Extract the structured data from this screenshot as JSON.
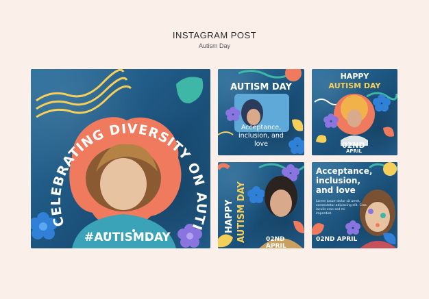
{
  "header": {
    "title": "INSTAGRAM POST",
    "subtitle": "Autism Day"
  },
  "post1": {
    "arc_text": "CELEBRATING DIVERSITY ON AUTISM DAY",
    "hashtag": "#AUTISMDAY"
  },
  "post2": {
    "title": "AUTISM DAY",
    "body_lines": [
      "Acceptance,",
      "inclusion, and",
      "love"
    ]
  },
  "post3": {
    "title_line1": "HAPPY",
    "title_line2": "AUTISM DAY",
    "date_day": "02ND",
    "date_month": "APRIL"
  },
  "post4": {
    "vertical_line1": "HAPPY",
    "vertical_line2": "AUTISM DAY",
    "date": "02ND APRIL"
  },
  "post5": {
    "heading_lines": [
      "Acceptance,",
      "inclusion,",
      "and love"
    ],
    "body_lines": [
      "Lorem ipsum dolor sit amet,",
      "consectetur adipiscing elit. Cras",
      "iaculis eros sed mi",
      "imperdiet."
    ],
    "date": "02ND APRIL"
  },
  "colors": {
    "navy": "#1f5f8a",
    "yellow": "#f6cf5a",
    "coral": "#f07a5e",
    "teal": "#3fb7a7",
    "purple": "#8a74e0",
    "background": "#fbefe9"
  }
}
